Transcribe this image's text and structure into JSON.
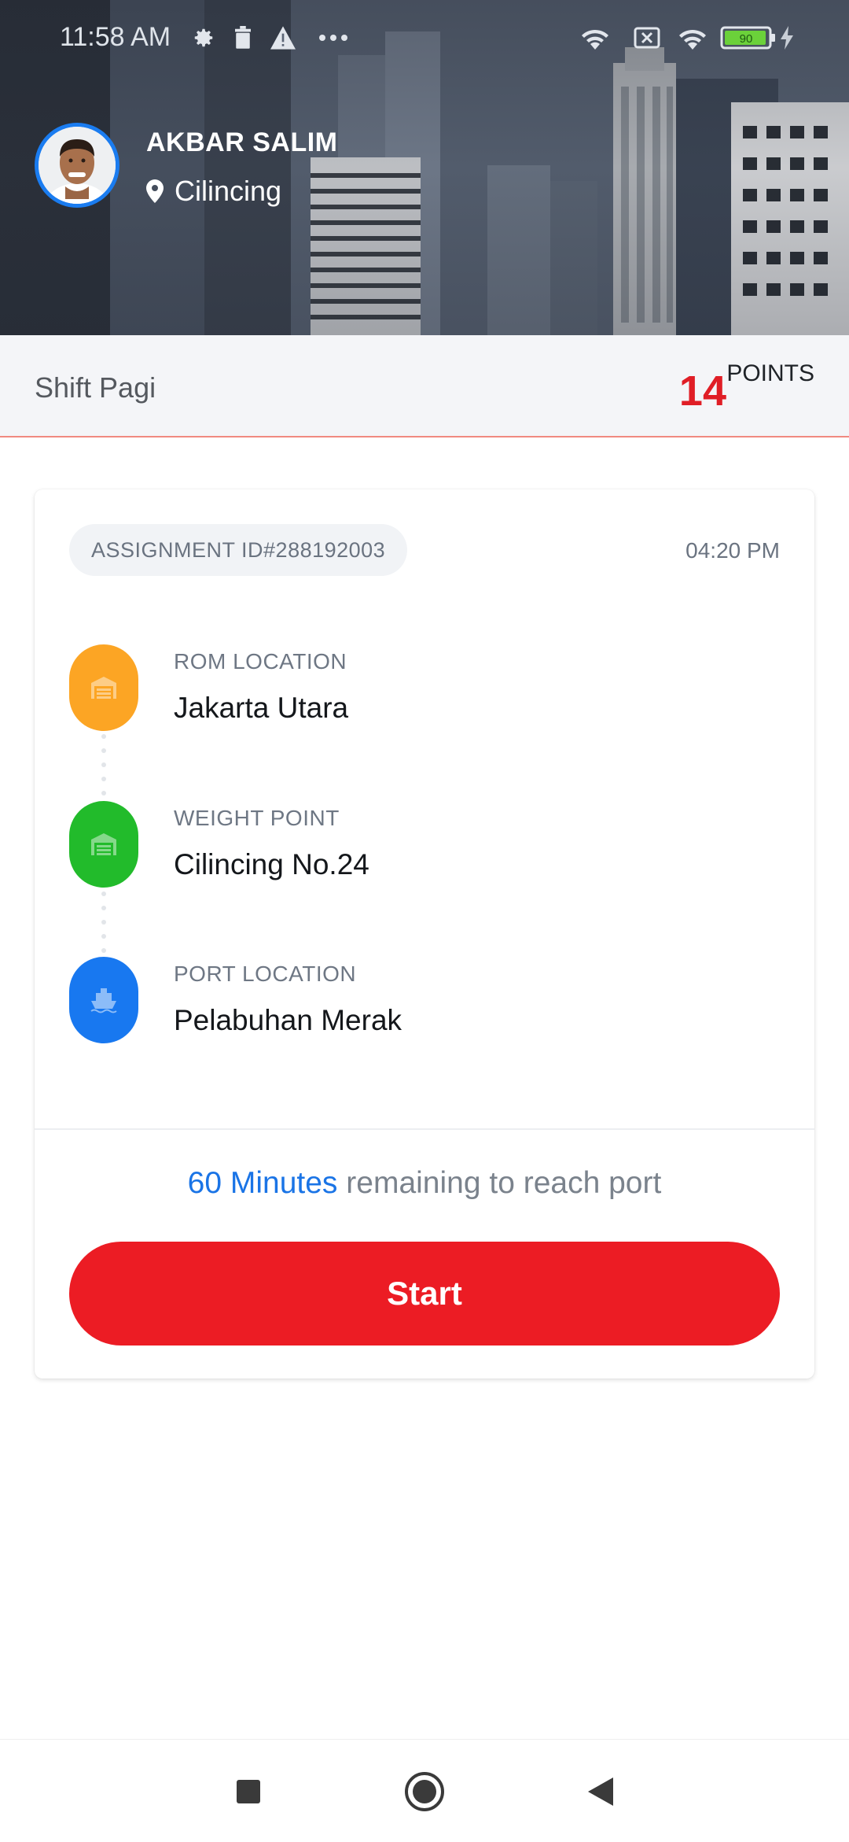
{
  "status_bar": {
    "time": "11:58 AM",
    "battery": "90",
    "left_icons": [
      "settings-icon",
      "trash-icon",
      "warning-icon",
      "more-icon"
    ],
    "right_icons": [
      "wifi-icon",
      "sim-icon",
      "wifi-icon",
      "battery-icon",
      "charging-icon"
    ]
  },
  "profile": {
    "name": "AKBAR SALIM",
    "location": "Cilincing"
  },
  "shift": {
    "label": "Shift Pagi",
    "points_value": "14",
    "points_unit": "POINTS"
  },
  "assignment": {
    "id_label": "ASSIGNMENT ID#288192003",
    "time": "04:20 PM",
    "stops": [
      {
        "label": "ROM LOCATION",
        "value": "Jakarta Utara",
        "color": "#fca524",
        "icon": "warehouse-icon"
      },
      {
        "label": "WEIGHT POINT",
        "value": "Cilincing No.24",
        "color": "#22bb2b",
        "icon": "warehouse-icon"
      },
      {
        "label": "PORT LOCATION",
        "value": "Pelabuhan Merak",
        "color": "#1878f0",
        "icon": "ship-icon"
      }
    ],
    "remaining_minutes": "60 Minutes",
    "remaining_text": " remaining to reach port",
    "start_label": "Start"
  },
  "colors": {
    "accent_red": "#ec1c24",
    "accent_blue": "#1a74e6",
    "avatar_border": "#1a7cf0"
  }
}
